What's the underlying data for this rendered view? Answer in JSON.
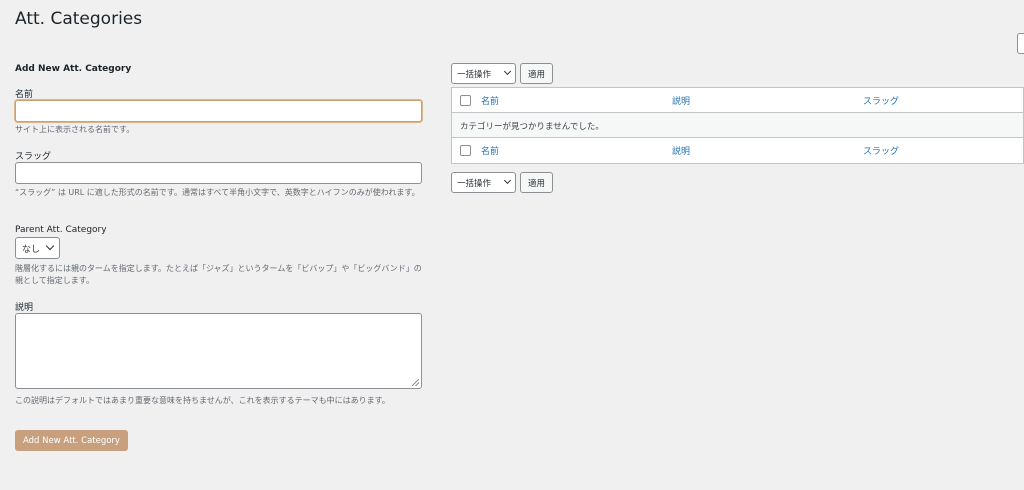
{
  "page": {
    "title": "Att. Categories"
  },
  "form": {
    "heading": "Add New Att. Category",
    "name_label": "名前",
    "name_value": "",
    "name_help": "サイト上に表示される名前です。",
    "slug_label": "スラッグ",
    "slug_value": "",
    "slug_help": "“スラッグ” は URL に適した形式の名前です。通常はすべて半角小文字で、英数字とハイフンのみが使われます。",
    "parent_label": "Parent Att. Category",
    "parent_value": "なし",
    "parent_help": "階層化するには親のタームを指定します。たとえば「ジャズ」というタームを「ビバップ」や「ビッグバンド」の親として指定します。",
    "description_label": "説明",
    "description_value": "",
    "description_help": "この説明はデフォルトではあまり重要な意味を持ちませんが、これを表示するテーマも中にはあります。",
    "submit_label": "Add New Att. Category"
  },
  "bulk": {
    "action_label": "一括操作",
    "apply_label": "適用"
  },
  "table": {
    "columns": [
      "名前",
      "説明",
      "スラッグ"
    ],
    "empty_message": "カテゴリーが見つかりませんでした。"
  },
  "colors": {
    "link": "#2271b1",
    "primary_button": "#c8a07e",
    "background": "#f0f0f1"
  }
}
